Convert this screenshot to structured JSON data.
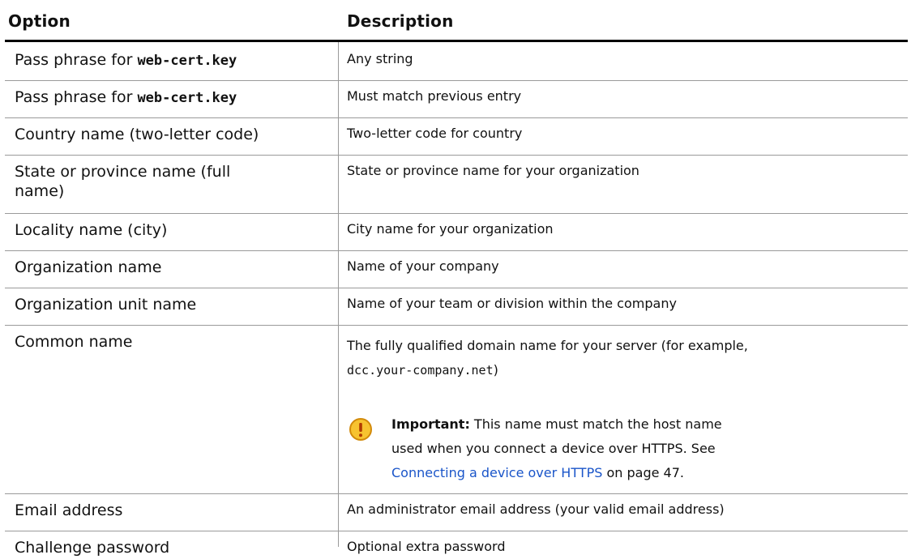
{
  "table": {
    "headers": {
      "option": "Option",
      "description": "Description"
    },
    "rows": [
      {
        "option_prefix": "Pass phrase for ",
        "option_code": "web-cert.key",
        "description": "Any string"
      },
      {
        "option_prefix": "Pass phrase for ",
        "option_code": "web-cert.key",
        "description": "Must match previous entry"
      },
      {
        "option": "Country name (two-letter code)",
        "description": "Two-letter code for country"
      },
      {
        "option_line1": "State or province name (full",
        "option_line2": "name)",
        "description": "State or province name for your organization"
      },
      {
        "option": "Locality name (city)",
        "description": "City name for your organization"
      },
      {
        "option": "Organization name",
        "description": "Name of your company"
      },
      {
        "option": "Organization unit name",
        "description": "Name of your team or division within the company"
      },
      {
        "option": "Common name",
        "description_line1": "The fully qualified domain name for your server (for example,",
        "description_code": "dcc.your-company.net",
        "description_tail": ")"
      },
      {
        "option": "Email address",
        "description": "An administrator email address (your valid email address)"
      },
      {
        "option": "Challenge password",
        "description": "Optional extra password"
      }
    ],
    "note": {
      "icon": "warning-icon",
      "label": "Important:",
      "line1": " This name must match the host name",
      "line2": "used when you connect a device over HTTPS. See",
      "link_text": "Connecting a device over HTTPS",
      "tail": " on page 47."
    }
  },
  "colors": {
    "link": "#1a55c9",
    "icon_fill": "#f7c330",
    "icon_stroke": "#d28a0a"
  }
}
